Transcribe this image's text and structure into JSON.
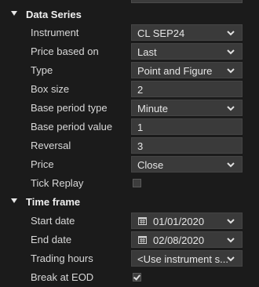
{
  "sections": {
    "data_series": {
      "label": "Data Series",
      "rows": {
        "instrument": {
          "label": "Instrument",
          "value": "CL SEP24"
        },
        "price_based_on": {
          "label": "Price based on",
          "value": "Last"
        },
        "type": {
          "label": "Type",
          "value": "Point and Figure"
        },
        "box_size": {
          "label": "Box size",
          "value": "2"
        },
        "base_period_type": {
          "label": "Base period type",
          "value": "Minute"
        },
        "base_period_value": {
          "label": "Base period value",
          "value": "1"
        },
        "reversal": {
          "label": "Reversal",
          "value": "3"
        },
        "price": {
          "label": "Price",
          "value": "Close"
        },
        "tick_replay": {
          "label": "Tick Replay",
          "checked": false
        }
      }
    },
    "time_frame": {
      "label": "Time frame",
      "rows": {
        "start_date": {
          "label": "Start date",
          "value": "01/01/2020"
        },
        "end_date": {
          "label": "End date",
          "value": "02/08/2020"
        },
        "trading_hours": {
          "label": "Trading hours",
          "value": "<Use instrument s..."
        },
        "break_at_eod": {
          "label": "Break at EOD",
          "checked": true
        }
      }
    }
  },
  "icons": {
    "expand": "triangle-down-icon",
    "dropdown": "chevron-down-icon",
    "calendar": "calendar-icon"
  },
  "colors": {
    "background": "#1b1b1b",
    "cell": "#3a3a3a",
    "text": "#dcdcdc"
  }
}
